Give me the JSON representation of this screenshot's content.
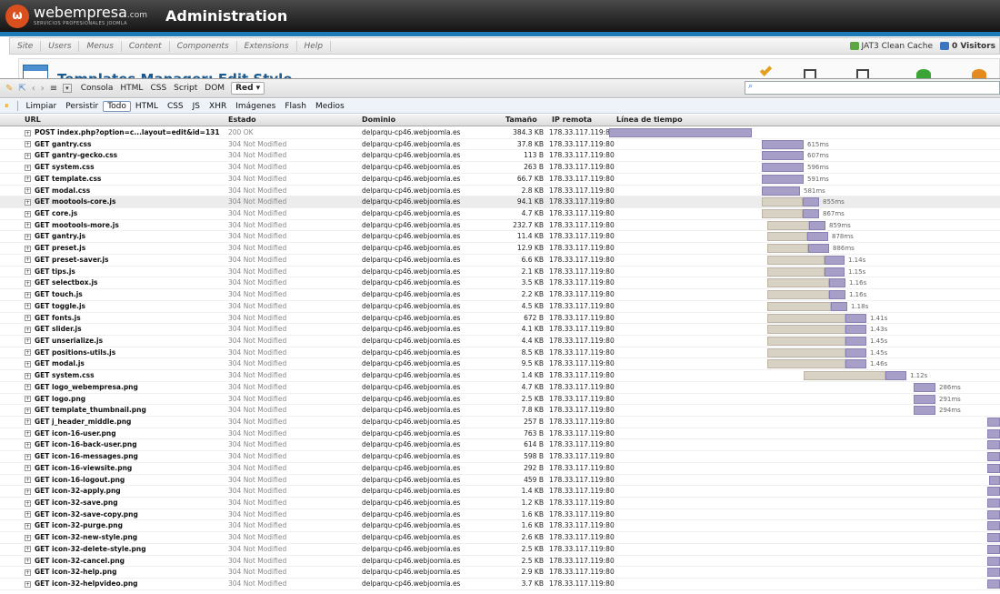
{
  "header": {
    "brand": "webempresa",
    "brand_suffix": ".com",
    "brand_tagline": "SERVICIOS PROFESIONALES JOOMLA",
    "title": "Administration"
  },
  "menu": {
    "items": [
      "Site",
      "Users",
      "Menus",
      "Content",
      "Components",
      "Extensions",
      "Help"
    ],
    "cache_label": "JAT3 Clean Cache",
    "visitors_label": "0 Visitors"
  },
  "page": {
    "title": "Templates Manager: Edit Style"
  },
  "firebug": {
    "tabs": [
      "Consola",
      "HTML",
      "CSS",
      "Script",
      "DOM"
    ],
    "active_tab": "Red ▾",
    "filters": [
      "Limpiar",
      "Persistir",
      "Todo",
      "HTML",
      "CSS",
      "JS",
      "XHR",
      "Imágenes",
      "Flash",
      "Medios"
    ],
    "active_filter": "Todo"
  },
  "columns": {
    "url": "URL",
    "status": "Estado",
    "domain": "Dominio",
    "size": "Tamaño",
    "ip": "IP remota",
    "timeline": "Línea de tiempo"
  },
  "requests": [
    {
      "url": "POST index.php?option=c...layout=edit&id=131",
      "status": "200 OK",
      "domain": "delparqu-cp46.webjoomla.es",
      "size": "384.3 KB",
      "ip": "178.33.117.119:80",
      "time": "",
      "start": 0,
      "wait": 0,
      "recv": 157
    },
    {
      "url": "GET gantry.css",
      "status": "304 Not Modified",
      "domain": "delparqu-cp46.webjoomla.es",
      "size": "37.8 KB",
      "ip": "178.33.117.119:80",
      "time": "615ms",
      "start": 168,
      "wait": 0,
      "recv": 46
    },
    {
      "url": "GET gantry-gecko.css",
      "status": "304 Not Modified",
      "domain": "delparqu-cp46.webjoomla.es",
      "size": "113 B",
      "ip": "178.33.117.119:80",
      "time": "607ms",
      "start": 168,
      "wait": 0,
      "recv": 46
    },
    {
      "url": "GET system.css",
      "status": "304 Not Modified",
      "domain": "delparqu-cp46.webjoomla.es",
      "size": "263 B",
      "ip": "178.33.117.119:80",
      "time": "596ms",
      "start": 168,
      "wait": 0,
      "recv": 46
    },
    {
      "url": "GET template.css",
      "status": "304 Not Modified",
      "domain": "delparqu-cp46.webjoomla.es",
      "size": "66.7 KB",
      "ip": "178.33.117.119:80",
      "time": "591ms",
      "start": 168,
      "wait": 0,
      "recv": 46
    },
    {
      "url": "GET modal.css",
      "status": "304 Not Modified",
      "domain": "delparqu-cp46.webjoomla.es",
      "size": "2.8 KB",
      "ip": "178.33.117.119:80",
      "time": "581ms",
      "start": 168,
      "wait": 0,
      "recv": 42
    },
    {
      "url": "GET mootools-core.js",
      "status": "304 Not Modified",
      "domain": "delparqu-cp46.webjoomla.es",
      "size": "94.1 KB",
      "ip": "178.33.117.119:80",
      "time": "855ms",
      "start": 168,
      "wait": 45,
      "recv": 18
    },
    {
      "url": "GET core.js",
      "status": "304 Not Modified",
      "domain": "delparqu-cp46.webjoomla.es",
      "size": "4.7 KB",
      "ip": "178.33.117.119:80",
      "time": "867ms",
      "start": 168,
      "wait": 45,
      "recv": 18
    },
    {
      "url": "GET mootools-more.js",
      "status": "304 Not Modified",
      "domain": "delparqu-cp46.webjoomla.es",
      "size": "232.7 KB",
      "ip": "178.33.117.119:80",
      "time": "859ms",
      "start": 174,
      "wait": 46,
      "recv": 18
    },
    {
      "url": "GET gantry.js",
      "status": "304 Not Modified",
      "domain": "delparqu-cp46.webjoomla.es",
      "size": "11.4 KB",
      "ip": "178.33.117.119:80",
      "time": "878ms",
      "start": 174,
      "wait": 44,
      "recv": 23
    },
    {
      "url": "GET preset.js",
      "status": "304 Not Modified",
      "domain": "delparqu-cp46.webjoomla.es",
      "size": "12.9 KB",
      "ip": "178.33.117.119:80",
      "time": "886ms",
      "start": 174,
      "wait": 45,
      "recv": 23
    },
    {
      "url": "GET preset-saver.js",
      "status": "304 Not Modified",
      "domain": "delparqu-cp46.webjoomla.es",
      "size": "6.6 KB",
      "ip": "178.33.117.119:80",
      "time": "1.14s",
      "start": 174,
      "wait": 63,
      "recv": 22
    },
    {
      "url": "GET tips.js",
      "status": "304 Not Modified",
      "domain": "delparqu-cp46.webjoomla.es",
      "size": "2.1 KB",
      "ip": "178.33.117.119:80",
      "time": "1.15s",
      "start": 174,
      "wait": 63,
      "recv": 22
    },
    {
      "url": "GET selectbox.js",
      "status": "304 Not Modified",
      "domain": "delparqu-cp46.webjoomla.es",
      "size": "3.5 KB",
      "ip": "178.33.117.119:80",
      "time": "1.16s",
      "start": 174,
      "wait": 68,
      "recv": 18
    },
    {
      "url": "GET touch.js",
      "status": "304 Not Modified",
      "domain": "delparqu-cp46.webjoomla.es",
      "size": "2.2 KB",
      "ip": "178.33.117.119:80",
      "time": "1.16s",
      "start": 174,
      "wait": 68,
      "recv": 18
    },
    {
      "url": "GET toggle.js",
      "status": "304 Not Modified",
      "domain": "delparqu-cp46.webjoomla.es",
      "size": "4.5 KB",
      "ip": "178.33.117.119:80",
      "time": "1.18s",
      "start": 174,
      "wait": 70,
      "recv": 18
    },
    {
      "url": "GET fonts.js",
      "status": "304 Not Modified",
      "domain": "delparqu-cp46.webjoomla.es",
      "size": "672 B",
      "ip": "178.33.117.119:80",
      "time": "1.41s",
      "start": 174,
      "wait": 86,
      "recv": 23
    },
    {
      "url": "GET slider.js",
      "status": "304 Not Modified",
      "domain": "delparqu-cp46.webjoomla.es",
      "size": "4.1 KB",
      "ip": "178.33.117.119:80",
      "time": "1.43s",
      "start": 174,
      "wait": 86,
      "recv": 23
    },
    {
      "url": "GET unserialize.js",
      "status": "304 Not Modified",
      "domain": "delparqu-cp46.webjoomla.es",
      "size": "4.4 KB",
      "ip": "178.33.117.119:80",
      "time": "1.45s",
      "start": 174,
      "wait": 86,
      "recv": 23
    },
    {
      "url": "GET positions-utils.js",
      "status": "304 Not Modified",
      "domain": "delparqu-cp46.webjoomla.es",
      "size": "8.5 KB",
      "ip": "178.33.117.119:80",
      "time": "1.45s",
      "start": 174,
      "wait": 86,
      "recv": 23
    },
    {
      "url": "GET modal.js",
      "status": "304 Not Modified",
      "domain": "delparqu-cp46.webjoomla.es",
      "size": "9.5 KB",
      "ip": "178.33.117.119:80",
      "time": "1.46s",
      "start": 174,
      "wait": 86,
      "recv": 23
    },
    {
      "url": "GET system.css",
      "status": "304 Not Modified",
      "domain": "delparqu-cp46.webjoomla.es",
      "size": "1.4 KB",
      "ip": "178.33.117.119:80",
      "time": "1.12s",
      "start": 214,
      "wait": 90,
      "recv": 23
    },
    {
      "url": "GET logo_webempresa.png",
      "status": "304 Not Modified",
      "domain": "delparqu-cp46.webjoomla.es",
      "size": "4.7 KB",
      "ip": "178.33.117.119:80",
      "time": "286ms",
      "start": 335,
      "wait": 0,
      "recv": 24
    },
    {
      "url": "GET logo.png",
      "status": "304 Not Modified",
      "domain": "delparqu-cp46.webjoomla.es",
      "size": "2.5 KB",
      "ip": "178.33.117.119:80",
      "time": "291ms",
      "start": 335,
      "wait": 0,
      "recv": 24
    },
    {
      "url": "GET template_thumbnail.png",
      "status": "304 Not Modified",
      "domain": "delparqu-cp46.webjoomla.es",
      "size": "7.8 KB",
      "ip": "178.33.117.119:80",
      "time": "294ms",
      "start": 335,
      "wait": 0,
      "recv": 24
    },
    {
      "url": "GET j_header_middle.png",
      "status": "304 Not Modified",
      "domain": "delparqu-cp46.webjoomla.es",
      "size": "257 B",
      "ip": "178.33.117.119:80",
      "time": "",
      "start": 416,
      "wait": 0,
      "recv": 14
    },
    {
      "url": "GET icon-16-user.png",
      "status": "304 Not Modified",
      "domain": "delparqu-cp46.webjoomla.es",
      "size": "763 B",
      "ip": "178.33.117.119:80",
      "time": "",
      "start": 416,
      "wait": 0,
      "recv": 14
    },
    {
      "url": "GET icon-16-back-user.png",
      "status": "304 Not Modified",
      "domain": "delparqu-cp46.webjoomla.es",
      "size": "614 B",
      "ip": "178.33.117.119:80",
      "time": "",
      "start": 416,
      "wait": 0,
      "recv": 14
    },
    {
      "url": "GET icon-16-messages.png",
      "status": "304 Not Modified",
      "domain": "delparqu-cp46.webjoomla.es",
      "size": "598 B",
      "ip": "178.33.117.119:80",
      "time": "",
      "start": 416,
      "wait": 0,
      "recv": 14
    },
    {
      "url": "GET icon-16-viewsite.png",
      "status": "304 Not Modified",
      "domain": "delparqu-cp46.webjoomla.es",
      "size": "292 B",
      "ip": "178.33.117.119:80",
      "time": "",
      "start": 416,
      "wait": 0,
      "recv": 14
    },
    {
      "url": "GET icon-16-logout.png",
      "status": "304 Not Modified",
      "domain": "delparqu-cp46.webjoomla.es",
      "size": "459 B",
      "ip": "178.33.117.119:80",
      "time": "",
      "start": 418,
      "wait": 0,
      "recv": 12
    },
    {
      "url": "GET icon-32-apply.png",
      "status": "304 Not Modified",
      "domain": "delparqu-cp46.webjoomla.es",
      "size": "1.4 KB",
      "ip": "178.33.117.119:80",
      "time": "",
      "start": 416,
      "wait": 0,
      "recv": 14
    },
    {
      "url": "GET icon-32-save.png",
      "status": "304 Not Modified",
      "domain": "delparqu-cp46.webjoomla.es",
      "size": "1.2 KB",
      "ip": "178.33.117.119:80",
      "time": "",
      "start": 416,
      "wait": 0,
      "recv": 14
    },
    {
      "url": "GET icon-32-save-copy.png",
      "status": "304 Not Modified",
      "domain": "delparqu-cp46.webjoomla.es",
      "size": "1.6 KB",
      "ip": "178.33.117.119:80",
      "time": "",
      "start": 416,
      "wait": 0,
      "recv": 14
    },
    {
      "url": "GET icon-32-purge.png",
      "status": "304 Not Modified",
      "domain": "delparqu-cp46.webjoomla.es",
      "size": "1.6 KB",
      "ip": "178.33.117.119:80",
      "time": "",
      "start": 416,
      "wait": 0,
      "recv": 14
    },
    {
      "url": "GET icon-32-new-style.png",
      "status": "304 Not Modified",
      "domain": "delparqu-cp46.webjoomla.es",
      "size": "2.6 KB",
      "ip": "178.33.117.119:80",
      "time": "",
      "start": 416,
      "wait": 0,
      "recv": 14
    },
    {
      "url": "GET icon-32-delete-style.png",
      "status": "304 Not Modified",
      "domain": "delparqu-cp46.webjoomla.es",
      "size": "2.5 KB",
      "ip": "178.33.117.119:80",
      "time": "",
      "start": 416,
      "wait": 0,
      "recv": 14
    },
    {
      "url": "GET icon-32-cancel.png",
      "status": "304 Not Modified",
      "domain": "delparqu-cp46.webjoomla.es",
      "size": "2.5 KB",
      "ip": "178.33.117.119:80",
      "time": "",
      "start": 416,
      "wait": 0,
      "recv": 14
    },
    {
      "url": "GET icon-32-help.png",
      "status": "304 Not Modified",
      "domain": "delparqu-cp46.webjoomla.es",
      "size": "2.9 KB",
      "ip": "178.33.117.119:80",
      "time": "",
      "start": 416,
      "wait": 0,
      "recv": 14
    },
    {
      "url": "GET icon-32-helpvideo.png",
      "status": "304 Not Modified",
      "domain": "delparqu-cp46.webjoomla.es",
      "size": "3.7 KB",
      "ip": "178.33.117.119:80",
      "time": "",
      "start": 416,
      "wait": 0,
      "recv": 14
    }
  ],
  "colors": {
    "accent_blue": "#1f7ab8",
    "brand_orange": "#d94f1e",
    "bar_receive": "#a89fc9",
    "bar_wait": "#d8d2c4"
  }
}
